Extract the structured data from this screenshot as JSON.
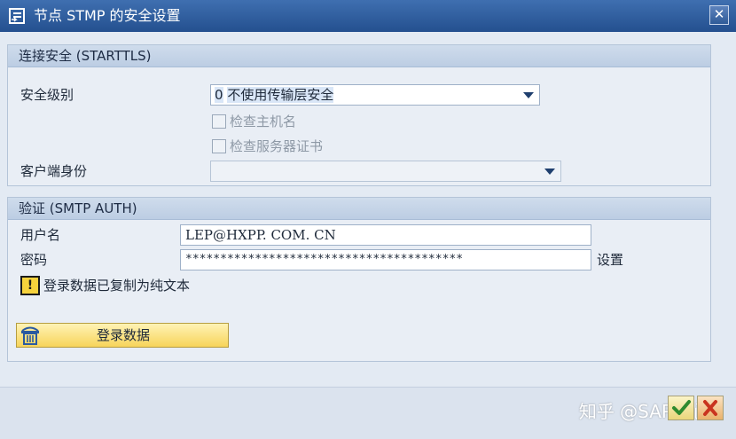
{
  "window": {
    "title": "节点 STMP 的安全设置",
    "close_glyph": "✕"
  },
  "connection_section": {
    "title": "连接安全 (STARTTLS)",
    "security_level_label": "安全级别",
    "security_level_code": "0",
    "security_level_value": "不使用传输层安全",
    "check_hostname_label": "检查主机名",
    "check_server_cert_label": "检查服务器证书",
    "client_identity_label": "客户端身份",
    "client_identity_value": ""
  },
  "auth_section": {
    "title": "验证 (SMTP AUTH)",
    "username_label": "用户名",
    "username_value": "LEP@HXPP. COM. CN",
    "password_label": "密码",
    "password_value": "****************************************",
    "set_label": "设置",
    "warning_glyph": "!",
    "warning_text": "登录数据已复制为纯文本",
    "login_button_label": "登录数据"
  },
  "watermark": "知乎 @SAP梦心",
  "colors": {
    "title_bar": "#2f5d9e",
    "button_yellow": "#f7d45a",
    "section_header": "#c7d6e9"
  },
  "icons": {
    "title": "window-icon",
    "trash": "trash-icon",
    "ok": "checkmark-icon",
    "cancel": "cancel-icon"
  }
}
